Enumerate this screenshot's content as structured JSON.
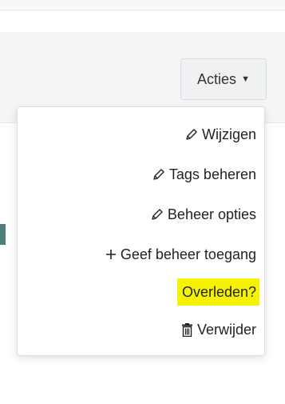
{
  "actions_button": {
    "label": "Acties"
  },
  "menu": {
    "items": [
      {
        "label": "Wijzigen",
        "icon": "pencil-icon"
      },
      {
        "label": "Tags beheren",
        "icon": "pencil-icon"
      },
      {
        "label": "Beheer opties",
        "icon": "pencil-icon"
      },
      {
        "label": "Geef beheer toegang",
        "icon": "plus-icon"
      },
      {
        "label": "Overleden?",
        "icon": "",
        "highlight": "#f7f300"
      },
      {
        "label": "Verwijder",
        "icon": "trash-icon"
      }
    ]
  }
}
